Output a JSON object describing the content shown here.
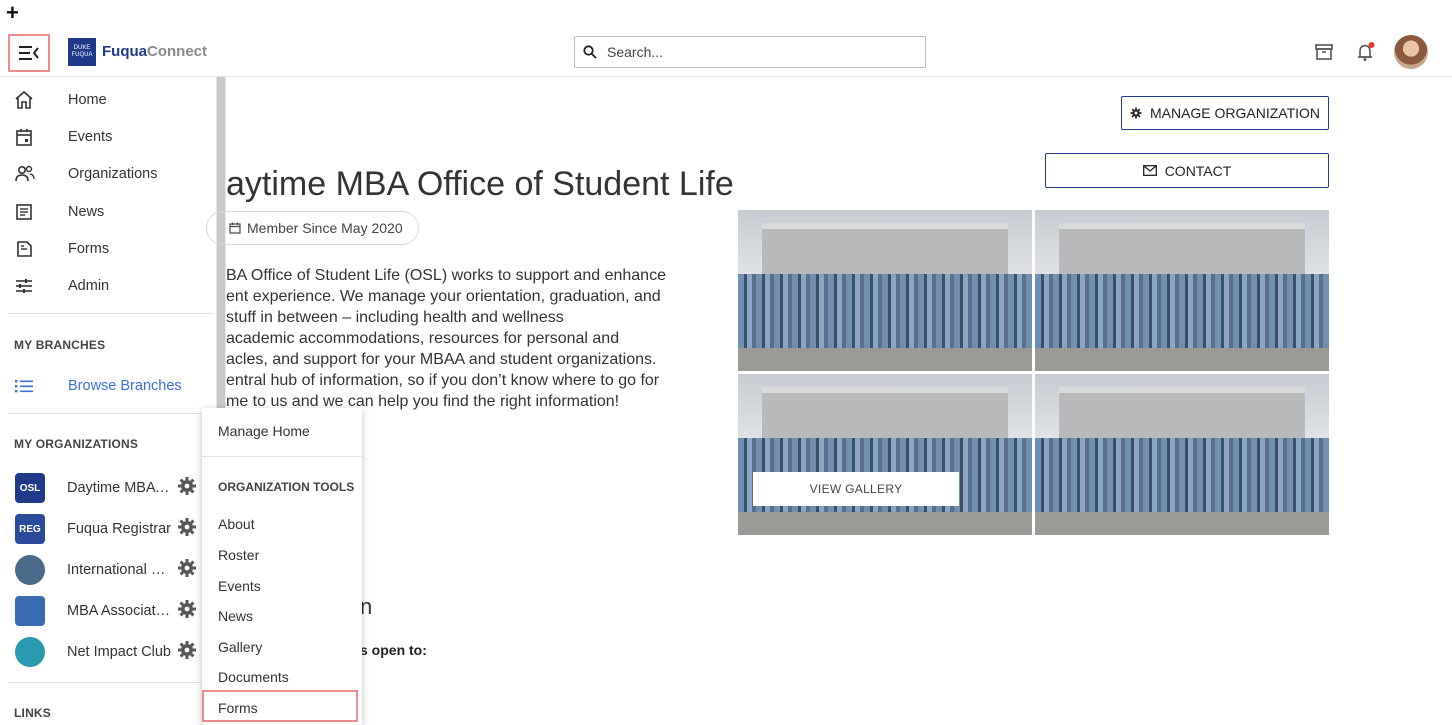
{
  "corner_mark": "+",
  "header": {
    "logo_box_line1": "DUKE",
    "logo_box_line2": "FUQUA",
    "logo_text_a": "Fuqua",
    "logo_text_b": "Connect",
    "search_placeholder": "Search..."
  },
  "sidebar": {
    "nav": [
      {
        "label": "Home",
        "icon": "home-icon"
      },
      {
        "label": "Events",
        "icon": "calendar-icon"
      },
      {
        "label": "Organizations",
        "icon": "people-icon"
      },
      {
        "label": "News",
        "icon": "news-icon"
      },
      {
        "label": "Forms",
        "icon": "forms-icon"
      },
      {
        "label": "Admin",
        "icon": "sliders-icon"
      }
    ],
    "my_branches_heading": "MY BRANCHES",
    "browse_branches": "Browse Branches",
    "my_orgs_heading": "MY ORGANIZATIONS",
    "orgs": [
      {
        "name": "Daytime MBA Office of Student Life",
        "avatar_text": "OSL",
        "color": "#1f3a8a"
      },
      {
        "name": "Fuqua Registrar",
        "avatar_text": "REG",
        "color": "#2a4a9a"
      },
      {
        "name": "International Students",
        "avatar_text": "",
        "color": "#4a6a8a"
      },
      {
        "name": "MBA Association",
        "avatar_text": "",
        "color": "#3a6ab0"
      },
      {
        "name": "Net Impact Club",
        "avatar_text": "",
        "color": "#2a9ab0"
      }
    ],
    "links_heading": "LINKS"
  },
  "main": {
    "title": "aytime MBA Office of Student Life",
    "member_since": "Member Since May 2020",
    "description_lines": [
      "BA Office of Student Life (OSL) works to support and enhance",
      "ent experience. We manage your orientation, graduation, and",
      " stuff in between – including health and wellness",
      " academic accommodations, resources for personal and",
      "acles, and support for your MBAA and student organizations.",
      "entral hub of information, so if you don’t know where to go for",
      "me to us and we can help you find the right information!"
    ],
    "sub_heading": "n",
    "open_to": "s open to:",
    "manage_btn": "MANAGE ORGANIZATION",
    "contact_btn": "CONTACT",
    "view_gallery": "VIEW GALLERY"
  },
  "dropdown": {
    "manage_home": "Manage Home",
    "section": "ORGANIZATION TOOLS",
    "items": [
      "About",
      "Roster",
      "Events",
      "News",
      "Gallery",
      "Documents",
      "Forms"
    ]
  },
  "colors": {
    "accent": "#1f3a8a",
    "link": "#3a6fd8",
    "highlight": "#f08a8f",
    "notification_dot": "#e53935"
  }
}
